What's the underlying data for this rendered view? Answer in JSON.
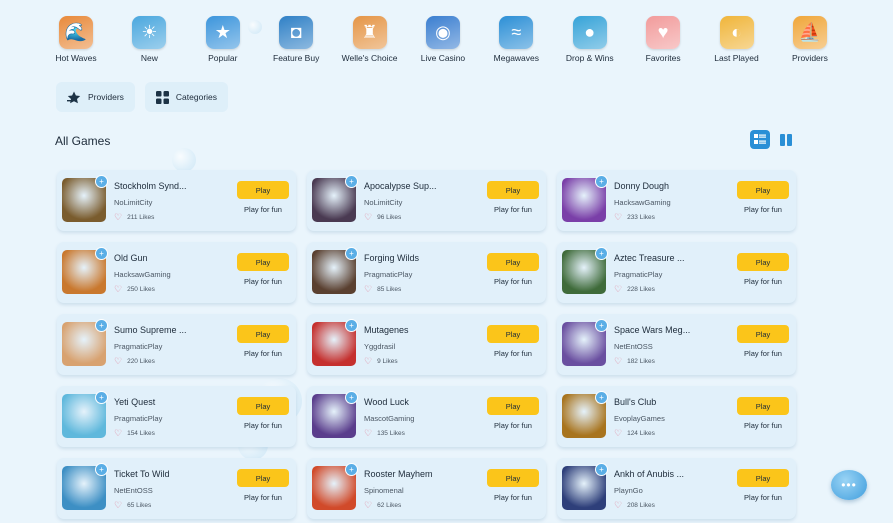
{
  "categories": [
    {
      "label": "Hot Waves",
      "icon": "flame-wave-icon",
      "glyph": "🌊",
      "color": "#e8893a"
    },
    {
      "label": "New",
      "icon": "sunset-icon",
      "glyph": "☀",
      "color": "#4aa7de"
    },
    {
      "label": "Popular",
      "icon": "star-icon",
      "glyph": "★",
      "color": "#3c95dc"
    },
    {
      "label": "Feature Buy",
      "icon": "treasure-chest-icon",
      "glyph": "◘",
      "color": "#2f80c6"
    },
    {
      "label": "Welle's Choice",
      "icon": "surfer-icon",
      "glyph": "♜",
      "color": "#e59546"
    },
    {
      "label": "Live Casino",
      "icon": "casino-chip-icon",
      "glyph": "◉",
      "color": "#3a7ed0"
    },
    {
      "label": "Megawaves",
      "icon": "big-wave-icon",
      "glyph": "≈",
      "color": "#2c8fd6"
    },
    {
      "label": "Drop & Wins",
      "icon": "drop-coin-icon",
      "glyph": "●",
      "color": "#36a3d8"
    },
    {
      "label": "Favorites",
      "icon": "heart-icon",
      "glyph": "♥",
      "color": "#f29b9b"
    },
    {
      "label": "Last Played",
      "icon": "wave-sun-icon",
      "glyph": "◐",
      "color": "#f0b53a"
    },
    {
      "label": "Providers",
      "icon": "sailboat-icon",
      "glyph": "⛵",
      "color": "#f0a63a"
    }
  ],
  "filters": {
    "providers_label": "Providers",
    "categories_label": "Categories"
  },
  "section": {
    "title": "All Games"
  },
  "card_labels": {
    "play": "Play",
    "fun": "Play for fun"
  },
  "games": [
    {
      "name": "Stockholm Synd...",
      "provider": "NoLimitCity",
      "likes": "211 Likes",
      "thumb_color": "#7a5c2e"
    },
    {
      "name": "Apocalypse Sup...",
      "provider": "NoLimitCity",
      "likes": "96 Likes",
      "thumb_color": "#4a3a52"
    },
    {
      "name": "Donny Dough",
      "provider": "HacksawGaming",
      "likes": "233 Likes",
      "thumb_color": "#7a3fa8"
    },
    {
      "name": "Old Gun",
      "provider": "HacksawGaming",
      "likes": "250 Likes",
      "thumb_color": "#c9782e"
    },
    {
      "name": "Forging Wilds",
      "provider": "PragmaticPlay",
      "likes": "85 Likes",
      "thumb_color": "#5a4030"
    },
    {
      "name": "Aztec Treasure ...",
      "provider": "PragmaticPlay",
      "likes": "228 Likes",
      "thumb_color": "#3f6b3a"
    },
    {
      "name": "Sumo Supreme ...",
      "provider": "PragmaticPlay",
      "likes": "220 Likes",
      "thumb_color": "#d8a270"
    },
    {
      "name": "Mutagenes",
      "provider": "Yggdrasil",
      "likes": "9 Likes",
      "thumb_color": "#c5302e"
    },
    {
      "name": "Space Wars Meg...",
      "provider": "NetEntOSS",
      "likes": "182 Likes",
      "thumb_color": "#6a4fa0"
    },
    {
      "name": "Yeti Quest",
      "provider": "PragmaticPlay",
      "likes": "154 Likes",
      "thumb_color": "#5fb8dc"
    },
    {
      "name": "Wood Luck",
      "provider": "MascotGaming",
      "likes": "135 Likes",
      "thumb_color": "#5a3d8c"
    },
    {
      "name": "Bull's Club",
      "provider": "EvoplayGames",
      "likes": "124 Likes",
      "thumb_color": "#a8741e"
    },
    {
      "name": "Ticket To Wild",
      "provider": "NetEntOSS",
      "likes": "65 Likes",
      "thumb_color": "#3d8fc4"
    },
    {
      "name": "Rooster Mayhem",
      "provider": "Spinomenal",
      "likes": "62 Likes",
      "thumb_color": "#d14a2a"
    },
    {
      "name": "Ankh of Anubis ...",
      "provider": "PlaynGo",
      "likes": "208 Likes",
      "thumb_color": "#2e3f7a"
    }
  ]
}
